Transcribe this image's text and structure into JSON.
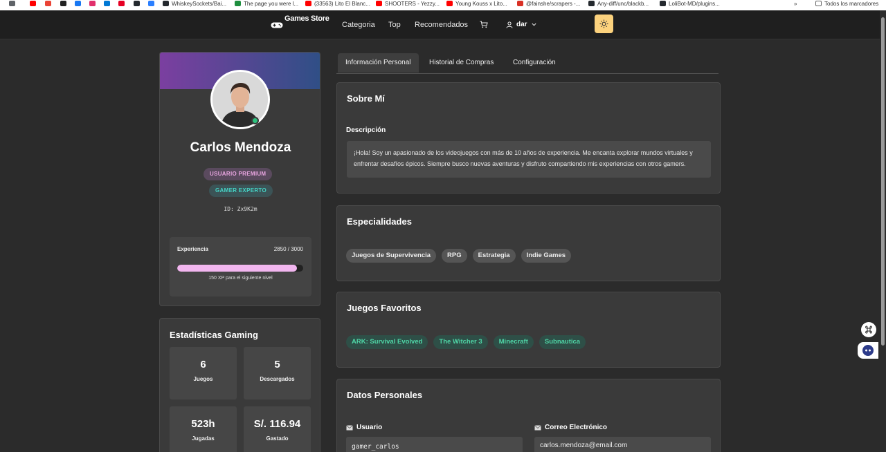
{
  "bookmarks": {
    "items": [
      {
        "label": "WhiskeySockets/Bai...",
        "color": "#24292e"
      },
      {
        "label": "The page you were l...",
        "color": "#1e8e3e"
      },
      {
        "label": "(33563) Lito El Blanc...",
        "color": "#ff0000"
      },
      {
        "label": "SHOOTERS - Yezzy...",
        "color": "#ff0000"
      },
      {
        "label": "Young Kouss x Lito...",
        "color": "#ff0000"
      },
      {
        "label": "@fainshe/scrapers -...",
        "color": "#d93025"
      },
      {
        "label": "Any-diff/unc/blackb...",
        "color": "#24292e"
      },
      {
        "label": "LoliBot-MD/plugins...",
        "color": "#24292e"
      }
    ],
    "more": "»",
    "all_bookmarks": "Todos los marcadores"
  },
  "navbar": {
    "logo": "Games Store",
    "links": [
      "Categoria",
      "Top",
      "Recomendados"
    ],
    "user": "dar"
  },
  "profile": {
    "name": "Carlos Mendoza",
    "badge_premium": "USUARIO PREMIUM",
    "badge_expert": "GAMER EXPERTO",
    "user_id": "ID: Zx9K2m",
    "xp_label": "Experiencia",
    "xp_value": "2850 / 3000",
    "xp_fraction": 0.95,
    "xp_note": "150 XP para el siguiente nivel"
  },
  "stats": {
    "title": "Estadísticas Gaming",
    "items": [
      {
        "value": "6",
        "label": "Juegos"
      },
      {
        "value": "5",
        "label": "Descargados"
      },
      {
        "value": "523h",
        "label": "Jugadas"
      },
      {
        "value": "S/. 116.94",
        "label": "Gastado"
      }
    ]
  },
  "tabs": [
    "Información Personal",
    "Historial de Compras",
    "Configuración"
  ],
  "about": {
    "title": "Sobre Mí",
    "label": "Descripción",
    "text": "¡Hola! Soy un apasionado de los videojuegos con más de 10 años de experiencia. Me encanta explorar mundos virtuales y enfrentar desafíos épicos. Siempre busco nuevas aventuras y disfruto compartiendo mis experiencias con otros gamers."
  },
  "specialties": {
    "title": "Especialidades",
    "items": [
      "Juegos de Supervivencia",
      "RPG",
      "Estrategia",
      "Indie Games"
    ]
  },
  "favorites": {
    "title": "Juegos Favoritos",
    "items": [
      "ARK: Survival Evolved",
      "The Witcher 3",
      "Minecraft",
      "Subnautica"
    ]
  },
  "personal": {
    "title": "Datos Personales",
    "username_label": "Usuario",
    "username": "gamer_carlos",
    "email_label": "Correo Electrónico",
    "email": "carlos.mendoza@email.com"
  },
  "colors": {
    "accent_banner_start": "#7b3fa0",
    "accent_banner_end": "#2f4f86",
    "theme_button": "#fcd27d",
    "online": "#2ec27e",
    "xp_fill": "#f2b6ef"
  }
}
